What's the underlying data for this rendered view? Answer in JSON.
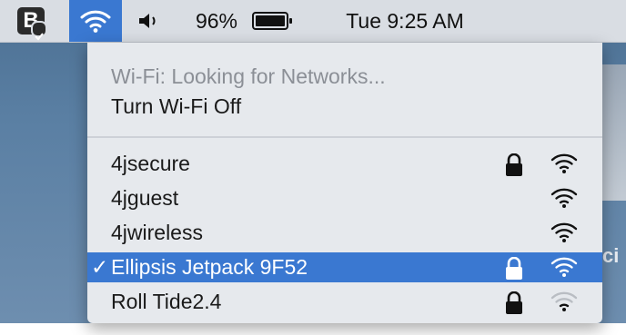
{
  "menubar": {
    "app_icon_letter": "B",
    "battery_percent": "96%",
    "clock": "Tue 9:25 AM",
    "icons": [
      "app-icon",
      "wifi-icon",
      "volume-icon",
      "battery-icon"
    ]
  },
  "wifi_menu": {
    "status": "Wi-Fi: Looking for Networks...",
    "turn_off": "Turn Wi-Fi Off",
    "networks": [
      {
        "name": "4jsecure",
        "locked": true,
        "signal": "full",
        "selected": false
      },
      {
        "name": "4jguest",
        "locked": false,
        "signal": "full",
        "selected": false
      },
      {
        "name": "4jwireless",
        "locked": false,
        "signal": "full",
        "selected": false
      },
      {
        "name": "Ellipsis Jetpack 9F52",
        "locked": true,
        "signal": "full",
        "selected": true,
        "checkmark": "✓"
      },
      {
        "name": "Roll Tide2.4",
        "locked": true,
        "signal": "weak",
        "selected": false
      }
    ]
  },
  "desktop": {
    "right_edge_text": "ci"
  },
  "colors": {
    "menubar_bg": "#d9dde3",
    "dropdown_bg": "#e6e9ed",
    "selection_blue": "#3a78d1",
    "disabled_text": "#8b8f96"
  }
}
